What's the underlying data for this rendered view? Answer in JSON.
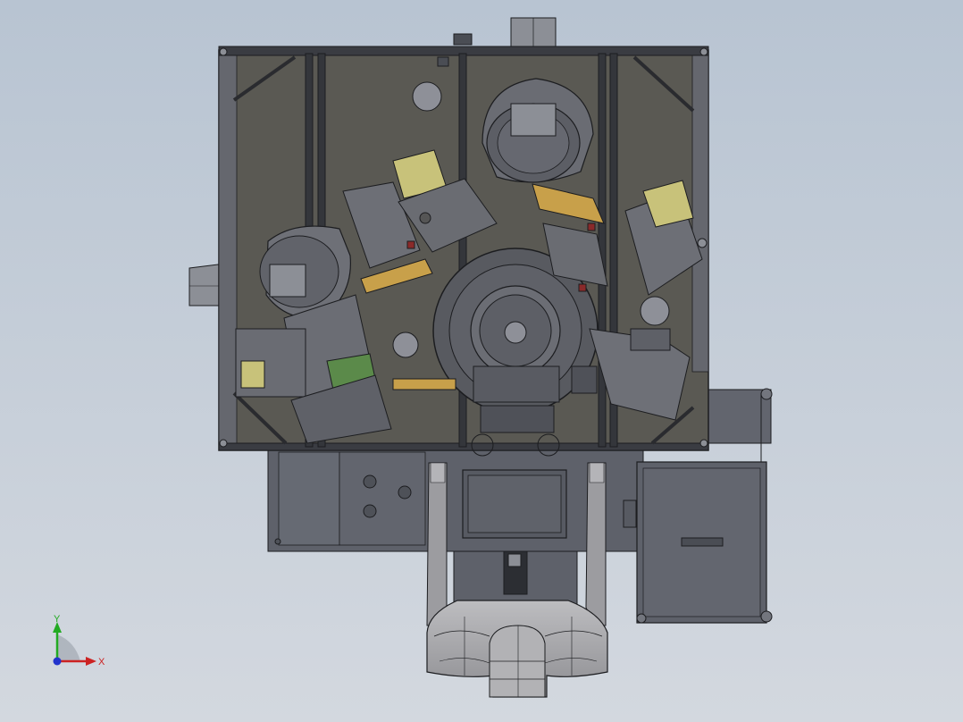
{
  "viewport": {
    "background_top": "#b8c4d2",
    "background_bottom": "#d3d8df"
  },
  "model": {
    "body_color": "#5e616a",
    "panel_color": "#6a6d77",
    "glass_color": "#5b5a55",
    "frame_color": "#2f3136",
    "edge_color": "#1c1d20",
    "accent_yellow": "#c8c27a",
    "accent_green": "#5b8a4a",
    "accent_red": "#8a2a2a",
    "hood_color": "#a9a9ab"
  },
  "triad": {
    "x_label": "X",
    "y_label": "Y",
    "x_color": "#cc2222",
    "y_color": "#22aa22",
    "z_color": "#2233cc"
  }
}
